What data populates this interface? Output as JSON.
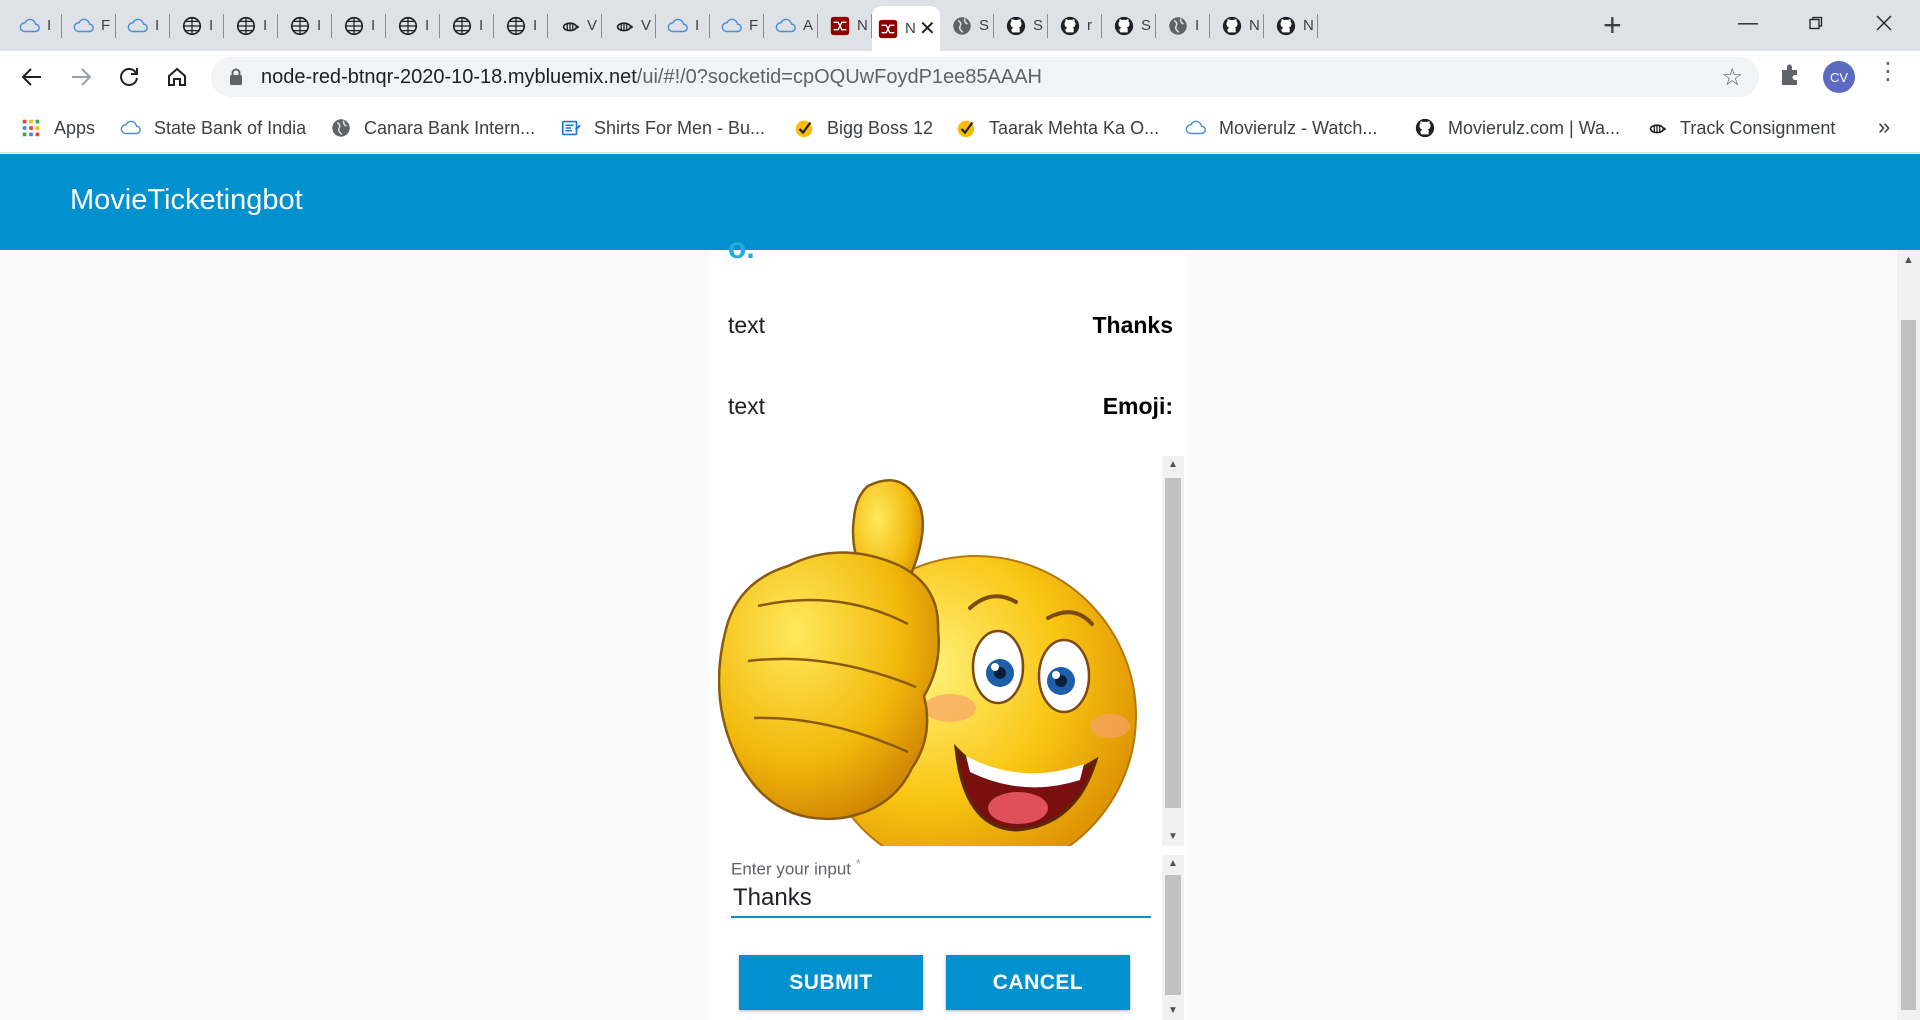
{
  "tabs": [
    {
      "icon": "cloud-icon",
      "title": "I"
    },
    {
      "icon": "cloud-icon",
      "title": "F"
    },
    {
      "icon": "cloud-icon",
      "title": "I"
    },
    {
      "icon": "ibm-globe-icon",
      "title": "I"
    },
    {
      "icon": "ibm-globe-icon",
      "title": "I"
    },
    {
      "icon": "ibm-globe-icon",
      "title": "I"
    },
    {
      "icon": "ibm-globe-icon",
      "title": "I"
    },
    {
      "icon": "ibm-globe-icon",
      "title": "I"
    },
    {
      "icon": "ibm-globe-icon",
      "title": "I"
    },
    {
      "icon": "ibm-globe-icon",
      "title": "I"
    },
    {
      "icon": "bee-icon",
      "title": "V"
    },
    {
      "icon": "bee-icon",
      "title": "V"
    },
    {
      "icon": "cloud-icon",
      "title": "I"
    },
    {
      "icon": "cloud-icon",
      "title": "F"
    },
    {
      "icon": "cloud-icon",
      "title": "A"
    },
    {
      "icon": "node-red-icon",
      "title": "N"
    },
    {
      "icon": "node-red-icon",
      "title": "N",
      "active": true
    },
    {
      "icon": "globe-icon",
      "title": "S"
    },
    {
      "icon": "github-icon",
      "title": "S"
    },
    {
      "icon": "github-icon",
      "title": "r"
    },
    {
      "icon": "github-icon",
      "title": "S"
    },
    {
      "icon": "globe-icon",
      "title": "I"
    },
    {
      "icon": "github-icon",
      "title": "N"
    },
    {
      "icon": "github-icon",
      "title": "N"
    }
  ],
  "address": {
    "host": "node-red-btnqr-2020-10-18.mybluemix.net",
    "path": "/ui/#!/0?socketid=cpOQUwFoydP1ee85AAAH"
  },
  "profile": {
    "initials": "CV"
  },
  "bookmarks": [
    {
      "icon": "apps-grid-icon",
      "label": "Apps"
    },
    {
      "icon": "cloud-icon",
      "label": "State Bank of India"
    },
    {
      "icon": "globe-icon",
      "label": "Canara Bank Intern..."
    },
    {
      "icon": "shirt-site-icon",
      "label": "Shirts For Men - Bu..."
    },
    {
      "icon": "check-badge-icon",
      "label": "Bigg Boss 12"
    },
    {
      "icon": "check-badge-icon",
      "label": "Taarak Mehta Ka O..."
    },
    {
      "icon": "cloud-icon",
      "label": "Movierulz - Watch..."
    },
    {
      "icon": "github-icon",
      "label": "Movierulz.com | Wa..."
    },
    {
      "icon": "bee-icon",
      "label": "Track Consignment"
    }
  ],
  "bookmarks_more": "»",
  "app": {
    "title": "MovieTicketingbot"
  },
  "chat": {
    "partial_top": "o.",
    "rows": [
      {
        "label": "text",
        "value": "Thanks"
      },
      {
        "label": "text",
        "value": "Emoji:"
      }
    ],
    "image": {
      "description": "thumbs-up-emoji-icon"
    }
  },
  "form": {
    "label": "Enter your input",
    "required_mark": "*",
    "value": "Thanks",
    "submit_label": "SUBMIT",
    "cancel_label": "CANCEL"
  },
  "colors": {
    "brand": "#0091ce",
    "tabstrip": "#dee1e6"
  }
}
